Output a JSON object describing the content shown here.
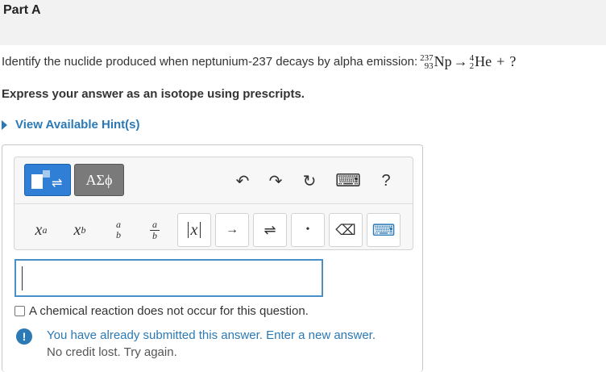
{
  "part": {
    "title": "Part A"
  },
  "question": {
    "text": "Identify the nuclide produced when neptunium-237 decays by alpha emission:",
    "equation": {
      "reactant": {
        "mass": "237",
        "atomic": "93",
        "symbol": "Np"
      },
      "arrow": "→",
      "product": {
        "mass": "4",
        "atomic": "2",
        "symbol": "He"
      },
      "plus": "+",
      "unknown": "?"
    }
  },
  "instruction": "Express your answer as an isotope using prescripts.",
  "hints": {
    "label": "View Available Hint(s)"
  },
  "toolbar": {
    "templates_icon": "templates-icon",
    "greek_label": "ΑΣϕ",
    "undo": "↶",
    "redo": "↷",
    "reset": "↻",
    "keyboard": "⌨",
    "help": "?",
    "superscript": {
      "base": "x",
      "sup": "a"
    },
    "subscript": {
      "base": "x",
      "sub": "b"
    },
    "prescripts": {
      "top": "a",
      "bottom": "b"
    },
    "fraction": {
      "num": "a",
      "den": "b"
    },
    "overline": "x",
    "reaction_arrow": "→",
    "equilibrium_arrow": "⇌",
    "dot": "•",
    "delete": "⌫",
    "keyboard_toggle": "⌨"
  },
  "answer": {
    "value": ""
  },
  "no_reaction": {
    "label": "A chemical reaction does not occur for this question.",
    "checked": false
  },
  "feedback": {
    "icon": "!",
    "message": "You have already submitted this answer. Enter a new answer.",
    "sub": "No credit lost. Try again."
  },
  "colors": {
    "accent": "#2b79b5",
    "template_button": "#2f7fd6",
    "greek_button": "#7a7a7a",
    "header_bg": "#f2f2f2"
  }
}
